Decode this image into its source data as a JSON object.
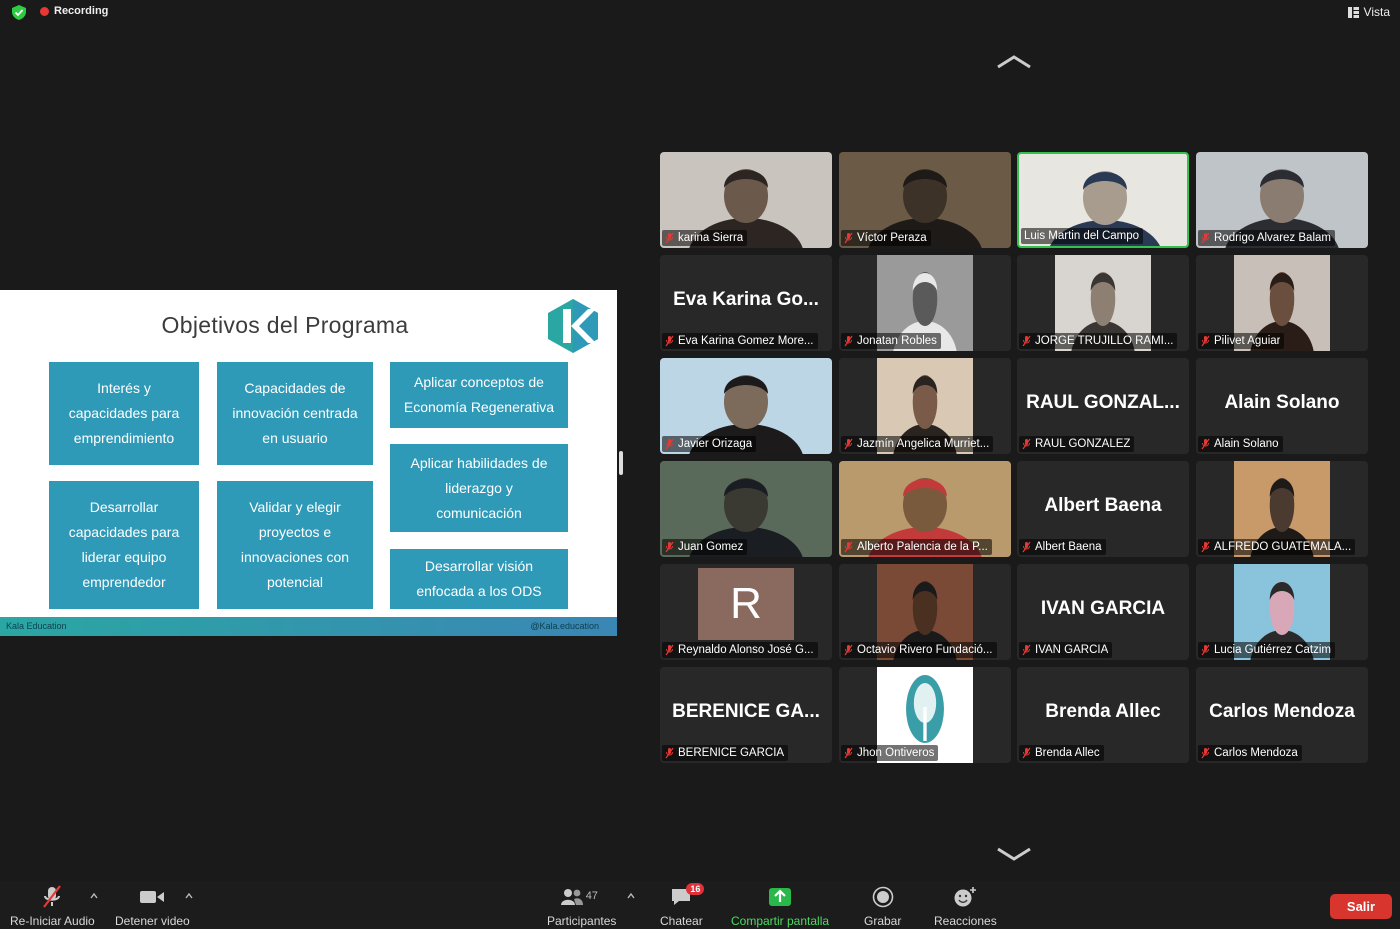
{
  "topbar": {
    "recording_label": "Recording",
    "view_label": "Vista"
  },
  "slide": {
    "title": "Objetivos del Programa",
    "boxes": [
      "Interés y\ncapacidades para\nemprendimiento",
      "Capacidades de\ninnovación centrada\nen usuario",
      "Aplicar conceptos de\nEconomía Regenerativa",
      "Aplicar habilidades de\nliderazgo y\ncomunicación",
      "Desarrollar\ncapacidades para\nliderar equipo\nemprendedor",
      "Validar y elegir\nproyectos e\ninnovaciones con\npotencial",
      "Desarrollar visión\nenfocada a los ODS"
    ],
    "footer_left": "Kala Education",
    "footer_right": "@Kala.education",
    "accent_color": "#2f9ab8"
  },
  "participants": [
    {
      "name": "karina Sierra",
      "display": "",
      "type": "video"
    },
    {
      "name": "Víctor Peraza",
      "display": "",
      "type": "video"
    },
    {
      "name": "Luis Martin del Campo",
      "display": "",
      "type": "video",
      "active_speaker": true
    },
    {
      "name": "Rodrigo Alvarez Balam",
      "display": "",
      "type": "video"
    },
    {
      "name": "Eva Karina Gomez More...",
      "display": "Eva Karina Go...",
      "type": "text"
    },
    {
      "name": "Jonatan Robles",
      "display": "",
      "type": "video"
    },
    {
      "name": "JORGE TRUJILLO RAMI...",
      "display": "",
      "type": "video"
    },
    {
      "name": "Pilivet Aguiar",
      "display": "",
      "type": "video"
    },
    {
      "name": "Javier Orizaga",
      "display": "",
      "type": "video"
    },
    {
      "name": "Jazmín Angelica Murriet...",
      "display": "",
      "type": "video"
    },
    {
      "name": "RAUL GONZALEZ",
      "display": "RAUL GONZAL...",
      "type": "text"
    },
    {
      "name": "Alain Solano",
      "display": "Alain Solano",
      "type": "text"
    },
    {
      "name": "Juan Gomez",
      "display": "",
      "type": "video"
    },
    {
      "name": "Alberto Palencia de la P...",
      "display": "",
      "type": "video"
    },
    {
      "name": "Albert Baena",
      "display": "Albert Baena",
      "type": "text"
    },
    {
      "name": "ALFREDO GUATEMALA...",
      "display": "",
      "type": "video"
    },
    {
      "name": "Reynaldo Alonso José G...",
      "display": "R",
      "type": "avatar"
    },
    {
      "name": "Octavio Rivero Fundació...",
      "display": "",
      "type": "video"
    },
    {
      "name": "IVAN GARCIA",
      "display": "IVAN GARCIA",
      "type": "text"
    },
    {
      "name": "Lucia Gutiérrez Catzim",
      "display": "",
      "type": "video"
    },
    {
      "name": "BERENICE GARCIA",
      "display": "BERENICE GA...",
      "type": "text"
    },
    {
      "name": "Jhon Ontiveros",
      "display": "",
      "type": "video"
    },
    {
      "name": "Brenda Allec",
      "display": "Brenda Allec",
      "type": "text"
    },
    {
      "name": "Carlos Mendoza",
      "display": "Carlos Mendoza",
      "type": "text"
    }
  ],
  "toolbar": {
    "audio_label": "Re-Iniciar Audio",
    "video_label": "Detener video",
    "participants_label": "Participantes",
    "participants_count": "47",
    "chat_label": "Chatear",
    "chat_badge": "16",
    "share_label": "Compartir pantalla",
    "record_label": "Grabar",
    "reactions_label": "Reacciones",
    "leave_label": "Salir"
  }
}
